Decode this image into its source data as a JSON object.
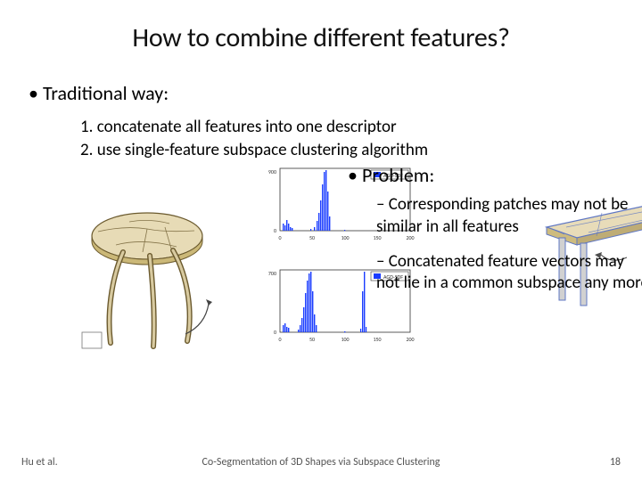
{
  "title": "How to combine different features?",
  "bullets": {
    "traditional": "Traditional way:",
    "steps": [
      "concatenate all features into one descriptor",
      "use single-feature subspace clustering algorithm"
    ],
    "problem": "Problem:",
    "problem_items": [
      "Corresponding patches may not be similar in all features",
      "Concatenated feature vectors may not lie in a common subspace any more"
    ]
  },
  "illustrations": {
    "round_table": "segmented-round-table",
    "rect_table": "rect-table-on-trestles",
    "histograms": [
      "feature-histogram-1",
      "feature-histogram-2"
    ],
    "legend": "AGD-SDF"
  },
  "chart_data": [
    {
      "type": "bar",
      "title": "",
      "xlabel": "",
      "ylabel": "",
      "xlim": [
        0,
        200
      ],
      "x_ticks": [
        0,
        50,
        100,
        150,
        200
      ],
      "ylim": [
        0,
        900
      ],
      "y_ticks": [
        0,
        900
      ],
      "legend": [
        "AGD-SDF"
      ],
      "series": [
        {
          "name": "AGD-SDF",
          "x": [
            6,
            8,
            10,
            12,
            15,
            18,
            20,
            30,
            50,
            55,
            60,
            65,
            68,
            70,
            72,
            74,
            76,
            78,
            80,
            82,
            100
          ],
          "values": [
            80,
            60,
            110,
            80,
            50,
            70,
            40,
            15,
            5,
            30,
            20,
            120,
            180,
            260,
            420,
            620,
            830,
            900,
            520,
            120,
            6
          ]
        }
      ]
    },
    {
      "type": "bar",
      "title": "",
      "xlabel": "",
      "ylabel": "",
      "xlim": [
        0,
        200
      ],
      "x_ticks": [
        0,
        50,
        100,
        150,
        200
      ],
      "ylim": [
        0,
        700
      ],
      "y_ticks": [
        0,
        700
      ],
      "legend": [
        "AGD-SDF"
      ],
      "series": [
        {
          "name": "AGD-SDF",
          "x": [
            6,
            8,
            10,
            12,
            30,
            32,
            34,
            36,
            38,
            40,
            42,
            44,
            46,
            48,
            50,
            52,
            100,
            125,
            126,
            127,
            128
          ],
          "values": [
            60,
            80,
            40,
            50,
            15,
            30,
            60,
            120,
            220,
            360,
            520,
            640,
            700,
            500,
            220,
            60,
            8,
            30,
            420,
            700,
            40
          ]
        }
      ]
    }
  ],
  "footer": {
    "left": "Hu et al.",
    "center": "Co-Segmentation of 3D Shapes via Subspace Clustering",
    "page": "18"
  },
  "colors": {
    "hist_bar": "#1a3cff",
    "hist_legend": "#2246ff",
    "table_top": "#e7dbb6",
    "table_edge": "#8a7544",
    "wood": "#c9bb90",
    "leg": "#bfbfbf"
  }
}
